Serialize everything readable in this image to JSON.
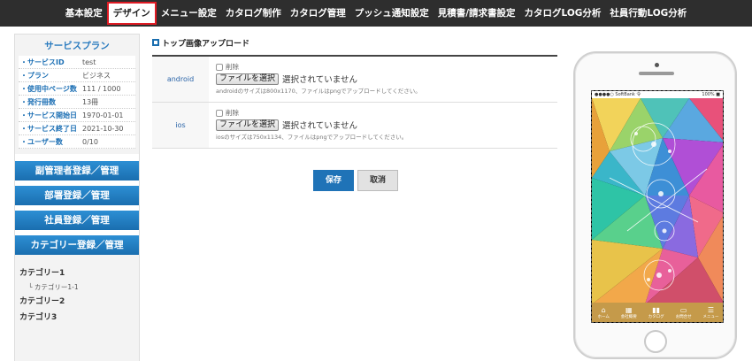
{
  "nav": {
    "items": [
      "基本設定",
      "デザイン",
      "メニュー設定",
      "カタログ制作",
      "カタログ管理",
      "プッシュ通知設定",
      "見積書/請求書設定",
      "カタログLOG分析",
      "社員行動LOG分析"
    ],
    "active_index": 1
  },
  "plan": {
    "title": "サービスプラン",
    "rows": [
      {
        "key": "・サービスID",
        "value": "test"
      },
      {
        "key": "・プラン",
        "value": "ビジネス"
      },
      {
        "key": "・使用中ページ数",
        "value": "111 / 1000"
      },
      {
        "key": "・発行冊数",
        "value": "13冊"
      },
      {
        "key": "・サービス開始日",
        "value": "1970-01-01"
      },
      {
        "key": "・サービス終了日",
        "value": "2021-10-30"
      },
      {
        "key": "・ユーザー数",
        "value": "0/10"
      }
    ]
  },
  "side_buttons": [
    "副管理者登録／管理",
    "部署登録／管理",
    "社員登録／管理",
    "カテゴリー登録／管理"
  ],
  "categories": [
    {
      "label": "カテゴリー1",
      "sub": [
        "└ カテゴリー1-1"
      ]
    },
    {
      "label": "カテゴリー2",
      "sub": []
    },
    {
      "label": "カテゴリ3",
      "sub": []
    }
  ],
  "upload": {
    "title": "トップ画像アップロード",
    "rows": [
      {
        "label": "android",
        "delete": "削除",
        "file_button": "ファイルを選択",
        "file_status": "選択されていません",
        "hint": "androidのサイズは800x1170、ファイルはpngでアップロードしてください。"
      },
      {
        "label": "ios",
        "delete": "削除",
        "file_button": "ファイルを選択",
        "file_status": "選択されていません",
        "hint": "iosのサイズは750x1134、ファイルはpngでアップロードしてください。"
      }
    ]
  },
  "actions": {
    "save": "保存",
    "cancel": "取消"
  },
  "phone": {
    "status_left": "●●●●○ SoftBank 令",
    "status_right": "100% ■",
    "tabs": [
      {
        "icon": "⌂",
        "label": "ホーム"
      },
      {
        "icon": "▦",
        "label": "会社概要"
      },
      {
        "icon": "▮▮",
        "label": "カタログ"
      },
      {
        "icon": "▭",
        "label": "お問合せ"
      },
      {
        "icon": "☰",
        "label": "メニュー"
      }
    ]
  },
  "colors": {
    "accent": "#1f73b7",
    "nav_bg": "#2e2e2e",
    "active_border": "#e01b24",
    "tabbar": "#c59a4a"
  }
}
